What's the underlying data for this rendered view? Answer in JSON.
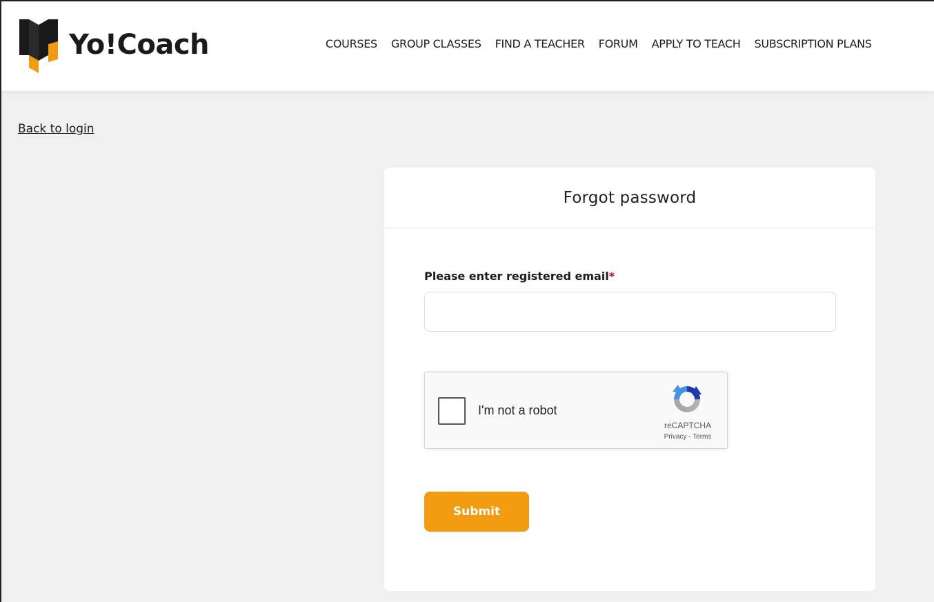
{
  "brand": {
    "name": "Yo!Coach",
    "colors": {
      "primary": "#f29b11",
      "dark": "#1a1a1a"
    }
  },
  "nav": {
    "items": [
      {
        "label": "COURSES"
      },
      {
        "label": "GROUP CLASSES"
      },
      {
        "label": "FIND A TEACHER"
      },
      {
        "label": "FORUM"
      },
      {
        "label": "APPLY TO TEACH"
      },
      {
        "label": "SUBSCRIPTION PLANS"
      }
    ]
  },
  "back_link": {
    "label": "Back to login"
  },
  "form": {
    "title": "Forgot password",
    "email_label": "Please enter registered email",
    "required_mark": "*",
    "email_value": "",
    "email_placeholder": "",
    "submit_label": "Submit"
  },
  "captcha": {
    "label": "I'm not a robot",
    "brand": "reCAPTCHA",
    "privacy": "Privacy",
    "separator": " - ",
    "terms": "Terms",
    "checked": false,
    "icon": "recaptcha-logo-icon"
  }
}
